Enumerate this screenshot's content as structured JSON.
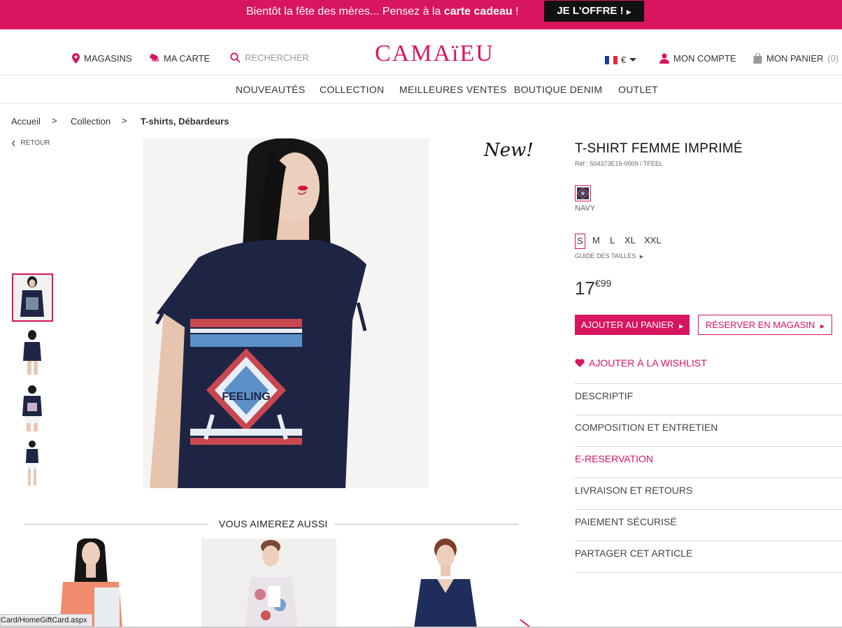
{
  "promo": {
    "text_prefix": "Bientôt la fête des mères... Pensez à la ",
    "text_bold": "carte cadeau",
    "text_suffix": " !",
    "cta": "JE L'OFFRE !"
  },
  "header": {
    "stores": "MAGASINS",
    "card": "MA CARTE",
    "search_placeholder": "RECHERCHER",
    "logo": "CAMAïEU",
    "currency": "€",
    "account": "MON COMPTE",
    "cart": "MON PANIER",
    "cart_count": "(0)"
  },
  "nav": {
    "items": [
      "NOUVEAUTÉS",
      "COLLECTION",
      "MEILLEURES VENTES",
      "BOUTIQUE DENIM",
      "OUTLET"
    ]
  },
  "breadcrumb": {
    "items": [
      "Accueil",
      "Collection",
      "T-shirts, Débardeurs"
    ],
    "sep": ">",
    "back": "RETOUR"
  },
  "product": {
    "badge": "New!",
    "title": "T-SHIRT FEMME IMPRIMÉ",
    "ref": "Réf : 504373E16-0009 / TFEEL",
    "color": "NAVY",
    "sizes": [
      "S",
      "M",
      "L",
      "XL",
      "XXL"
    ],
    "size_guide": "GUIDE DES TAILLES",
    "price_int": "17",
    "price_dec": "€99",
    "add_to_cart": "AJOUTER AU PANIER",
    "reserve": "RÉSERVER EN MAGASIN",
    "wishlist": "AJOUTER À LA WISHLIST",
    "print_word": "FEELING"
  },
  "accordion": [
    "DESCRIPTIF",
    "COMPOSITION ET ENTRETIEN",
    "E-RESERVATION",
    "LIVRAISON ET RETOURS",
    "PAIEMENT SÉCURISÉ",
    "PARTAGER CET ARTICLE"
  ],
  "related": {
    "title": "VOUS AIMEREZ AUSSI"
  },
  "status_bar": "Card/HomeGiftCard.aspx",
  "colors": {
    "brand": "#d8155f",
    "navy": "#1e2544"
  }
}
